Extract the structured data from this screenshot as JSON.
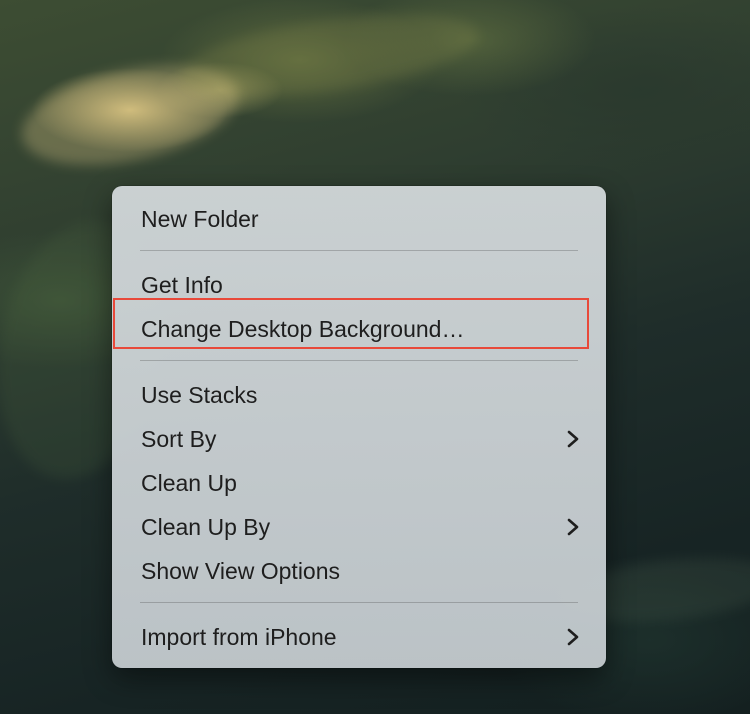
{
  "context_menu": {
    "items": [
      {
        "label": "New Folder",
        "has_submenu": false
      },
      {
        "label": "Get Info",
        "has_submenu": false
      },
      {
        "label": "Change Desktop Background…",
        "has_submenu": false
      },
      {
        "label": "Use Stacks",
        "has_submenu": false
      },
      {
        "label": "Sort By",
        "has_submenu": true
      },
      {
        "label": "Clean Up",
        "has_submenu": false
      },
      {
        "label": "Clean Up By",
        "has_submenu": true
      },
      {
        "label": "Show View Options",
        "has_submenu": false
      },
      {
        "label": "Import from iPhone",
        "has_submenu": true
      }
    ],
    "submenu_icon": "chevron-right-icon"
  },
  "highlight": {
    "target": "Change Desktop Background…",
    "color": "#e8493a"
  }
}
